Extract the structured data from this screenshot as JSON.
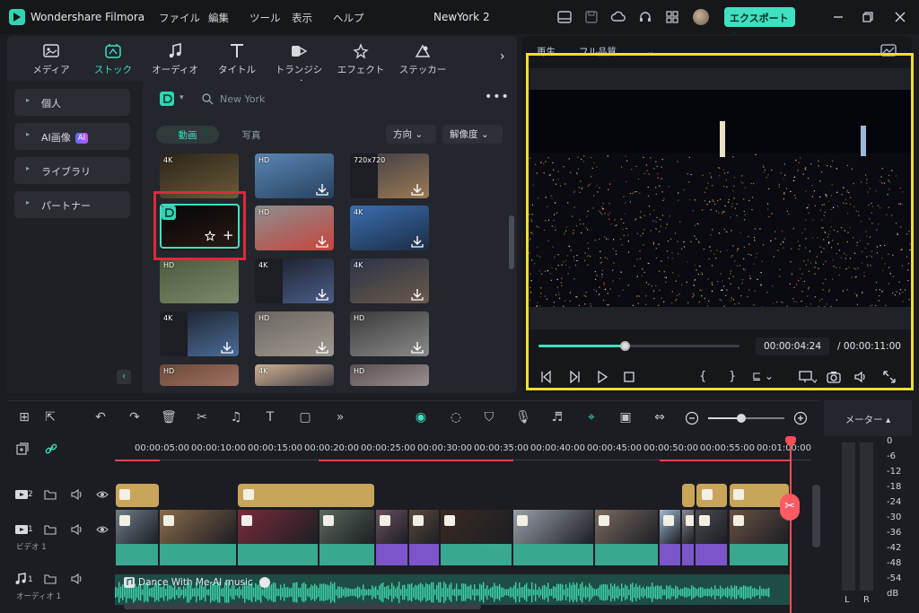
{
  "titlebar": {
    "app_name": "Wondershare Filmora",
    "menu": [
      "ファイル",
      "編集",
      "ツール",
      "表示",
      "ヘルプ"
    ],
    "project_name": "NewYork 2",
    "export_label": "エクスポート"
  },
  "library": {
    "tabs": [
      {
        "label": "メディア",
        "icon": "media-icon"
      },
      {
        "label": "ストック",
        "icon": "stock-icon",
        "active": true
      },
      {
        "label": "オーディオ",
        "icon": "music-note-icon"
      },
      {
        "label": "タイトル",
        "icon": "title-t-icon"
      },
      {
        "label": "トランジション",
        "icon": "transition-icon"
      },
      {
        "label": "エフェクト",
        "icon": "effects-star-icon"
      },
      {
        "label": "ステッカー",
        "icon": "sticker-icon"
      }
    ],
    "sidebar": [
      "個人",
      "AI画像",
      "ライブラリ",
      "パートナー"
    ],
    "ai_badge": "AI",
    "search_value": "New York",
    "filter_tabs": {
      "video": "動画",
      "photo": "写真"
    },
    "dropdowns": {
      "direction": "方向",
      "resolution": "解像度"
    },
    "thumbnails": [
      {
        "badge": "4K"
      },
      {
        "badge": "HD"
      },
      {
        "badge": "720x720"
      },
      {
        "badge": ""
      },
      {
        "badge": "HD"
      },
      {
        "badge": "4K"
      },
      {
        "badge": "HD"
      },
      {
        "badge": "4K"
      },
      {
        "badge": "4K"
      },
      {
        "badge": "4K"
      },
      {
        "badge": "HD"
      },
      {
        "badge": "HD"
      },
      {
        "badge": "HD"
      },
      {
        "badge": "4K"
      },
      {
        "badge": "HD"
      }
    ]
  },
  "preview": {
    "playback_label": "再生",
    "quality_label": "フル品質",
    "current_time": "00:00:04:24",
    "total_time": "00:00:11:00",
    "progress_fraction": 0.43
  },
  "timeline": {
    "ruler": [
      "00:00:05:00",
      "00:00:10:00",
      "00:00:15:00",
      "00:00:20:00",
      "00:00:25:00",
      "00:00:30:00",
      "00:00:35:00",
      "00:00:40:00",
      "00:00:45:00",
      "00:00:50:00",
      "00:00:55:00",
      "00:01:00:00"
    ],
    "tracks": {
      "video2_num": "2",
      "video1_num": "1",
      "video1_name": "ビデオ 1",
      "audio1_num": "1",
      "audio1_name": "オーディオ 1"
    },
    "audio_clip_title": "Dance With Me-AI music"
  },
  "meter": {
    "label": "メーター",
    "scale": [
      "0",
      "-6",
      "-12",
      "-18",
      "-24",
      "-30",
      "-36",
      "-42",
      "-48",
      "-54",
      "dB"
    ],
    "left": "L",
    "right": "R"
  },
  "colors": {
    "accent": "#3ee0c0",
    "highlight_box": "#f1de2f",
    "selection_box": "#e0283a",
    "playhead": "#ff4b55"
  }
}
